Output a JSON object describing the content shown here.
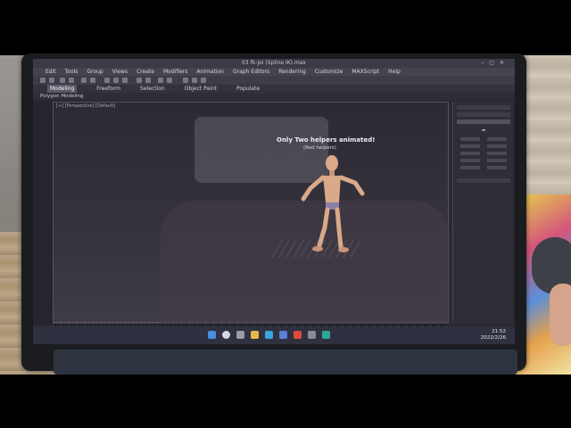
{
  "window": {
    "title": "03 fk-joi (Spline IK).max"
  },
  "menu": {
    "items": [
      "Edit",
      "Tools",
      "Group",
      "Views",
      "Create",
      "Modifiers",
      "Animation",
      "Graph Editors",
      "Rendering",
      "Customize",
      "MAXScript",
      "Help"
    ]
  },
  "ribbon": {
    "tabs": [
      "Modeling",
      "Freeform",
      "Selection",
      "Object Paint",
      "Populate"
    ],
    "active_tab": "Modeling",
    "sub_label": "Polygon Modeling"
  },
  "viewport": {
    "label": "[+] [Perspective] [Default]",
    "overlay_title": "Only Two helpers animated!",
    "overlay_subtitle": "(Red helpers)"
  },
  "taskbar": {
    "time": "21:52",
    "date": "2022/2/26"
  },
  "colors": {
    "viewport_bg": "#36333d",
    "ui_dark": "#2a2830",
    "figure_skin": "#d9a98a",
    "figure_shorts": "#8a7fa8"
  },
  "icons": {
    "taskbar": [
      "windows-icon",
      "search-icon",
      "taskview-icon",
      "explorer-icon",
      "edge-icon",
      "store-icon",
      "chrome-icon",
      "settings-icon",
      "3dsmax-icon"
    ]
  }
}
